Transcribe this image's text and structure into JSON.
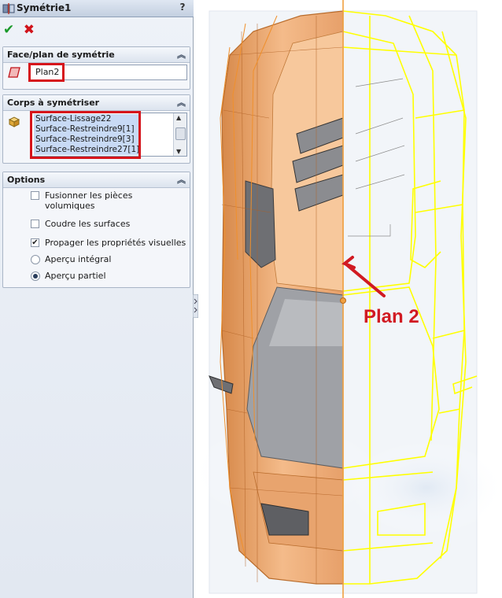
{
  "window": {
    "title": "Symétrie1",
    "help_label": "?"
  },
  "actions": {
    "ok_glyph": "✔",
    "cancel_glyph": "✖"
  },
  "face_group": {
    "title": "Face/plan de symétrie",
    "value": "Plan2"
  },
  "bodies_group": {
    "title": "Corps à symétriser",
    "items": [
      "Surface-Lissage22",
      "Surface-Restreindre9[1]",
      "Surface-Restreindre9[3]",
      "Surface-Restreindre27[1]"
    ]
  },
  "options_group": {
    "title": "Options",
    "options": [
      {
        "label": "Fusionner les pièces volumiques",
        "type": "checkbox",
        "checked": false
      },
      {
        "label": "Coudre les surfaces",
        "type": "checkbox",
        "checked": false
      },
      {
        "label": "Propager les propriétés visuelles",
        "type": "checkbox",
        "checked": true
      },
      {
        "label": "Aperçu intégral",
        "type": "radio",
        "checked": false
      },
      {
        "label": "Aperçu partiel",
        "type": "radio",
        "checked": true
      }
    ]
  },
  "viewport": {
    "annotation": "Plan 2",
    "colors": {
      "body_orange": "#e9a46b",
      "wire_yellow": "#ffff00",
      "plane_line": "#f0a040",
      "annotation_red": "#d11a22"
    }
  }
}
